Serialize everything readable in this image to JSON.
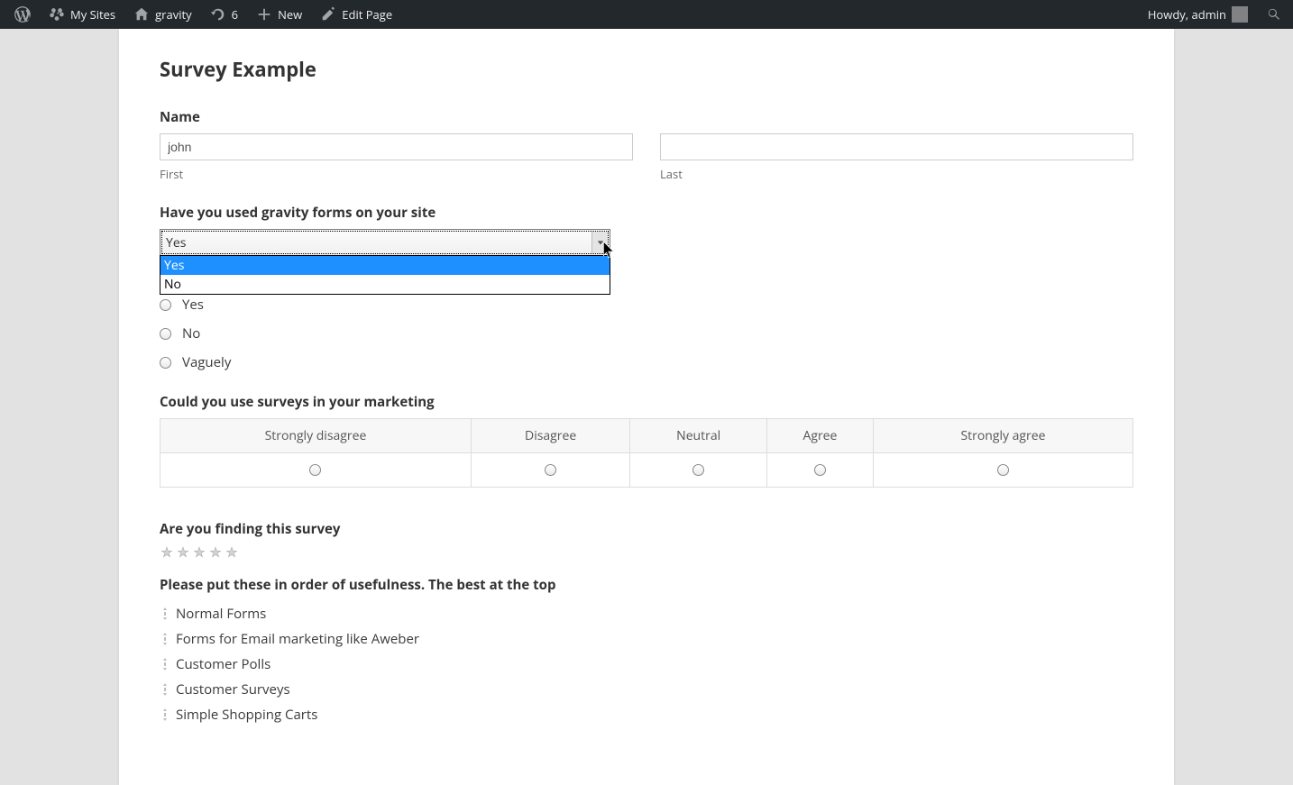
{
  "adminbar": {
    "my_sites": "My Sites",
    "site_name": "gravity",
    "updates_count": "6",
    "new_label": "New",
    "edit_page": "Edit Page",
    "howdy": "Howdy, admin"
  },
  "page": {
    "title": "Survey Example"
  },
  "form": {
    "name": {
      "label": "Name",
      "first_value": "john",
      "first_sub": "First",
      "last_value": "",
      "last_sub": "Last"
    },
    "usage_select": {
      "label": "Have you used gravity forms on your site",
      "value": "Yes",
      "options": [
        "Yes",
        "No"
      ]
    },
    "radio": {
      "options": [
        "Yes",
        "No",
        "Vaguely"
      ]
    },
    "likert": {
      "label": "Could you use surveys in your marketing",
      "columns": [
        "Strongly disagree",
        "Disagree",
        "Neutral",
        "Agree",
        "Strongly agree"
      ]
    },
    "rating": {
      "label": "Are you finding this survey",
      "count": 5
    },
    "sortable": {
      "label": "Please put these in order of usefulness. The best at the top",
      "items": [
        "Normal Forms",
        "Forms for Email marketing like Aweber",
        "Customer Polls",
        "Customer Surveys",
        "Simple Shopping Carts"
      ]
    }
  }
}
